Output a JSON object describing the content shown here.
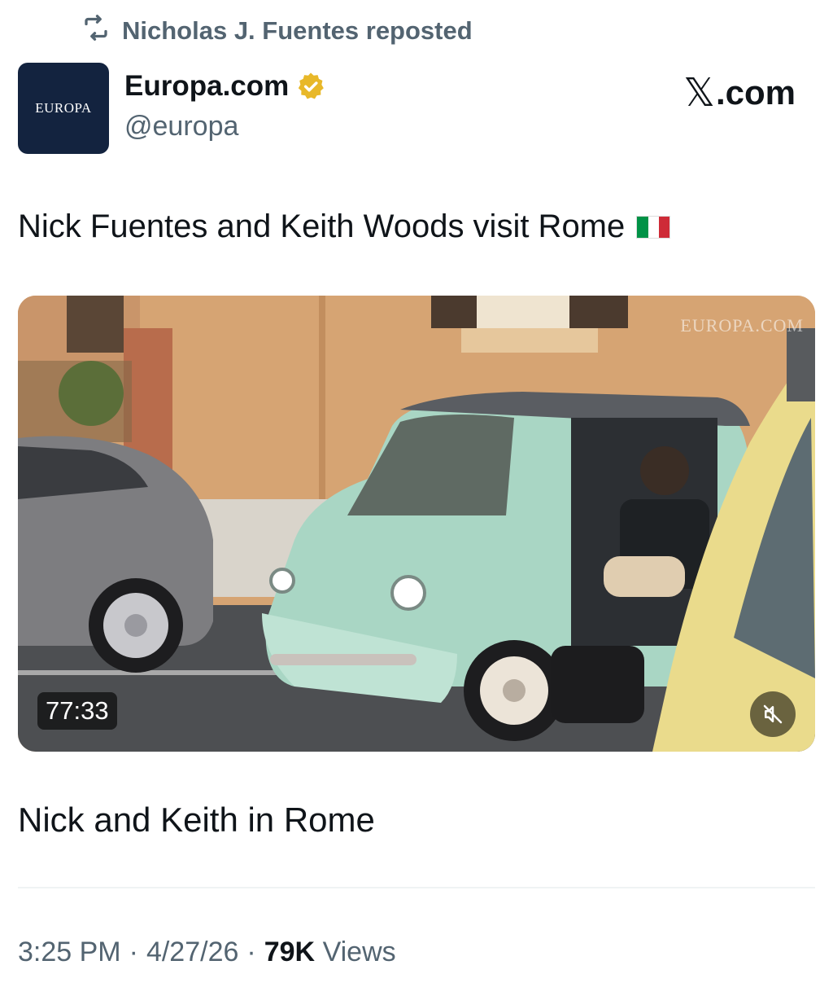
{
  "repost": {
    "label": "Nicholas J. Fuentes reposted",
    "icon": "repost-icon"
  },
  "author": {
    "avatar_text": "EUROPA",
    "name": "Europa.com",
    "handle": "@europa",
    "verified": true,
    "badge_color": "#e8b829"
  },
  "brand": {
    "x_glyph": "𝕏",
    "suffix": ".com"
  },
  "post": {
    "text": "Nick Fuentes and Keith Woods visit Rome",
    "flag_emoji": "🇮🇹"
  },
  "media": {
    "watermark": "EUROPA.COM",
    "duration": "77:33",
    "mute_icon": "muted-speaker-icon"
  },
  "caption": "Nick and Keith in Rome",
  "meta": {
    "time": "3:25 PM",
    "date": "4/27/26",
    "views_count": "79K",
    "views_label": "Views",
    "separator": "·"
  },
  "colors": {
    "text_primary": "#0f1419",
    "text_secondary": "#536471",
    "avatar_bg": "#13233f",
    "divider": "#eff3f4"
  }
}
